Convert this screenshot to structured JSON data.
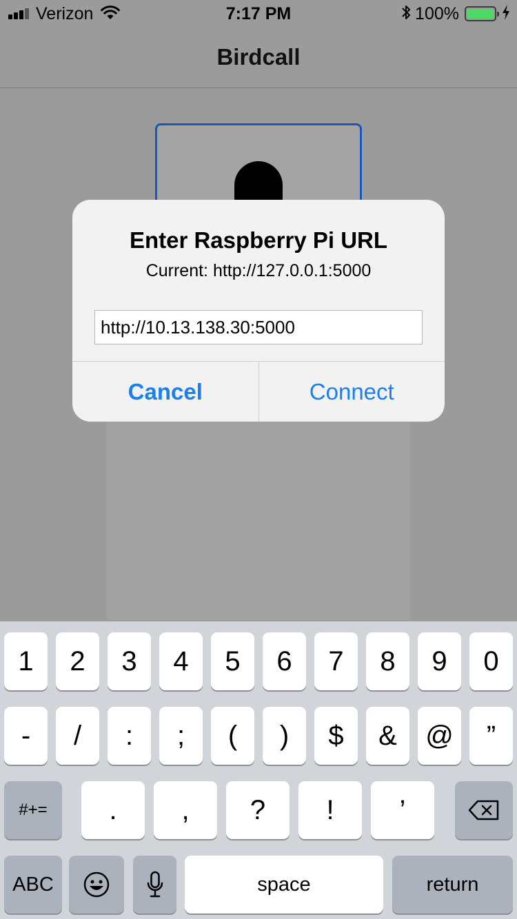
{
  "status_bar": {
    "carrier": "Verizon",
    "time": "7:17 PM",
    "battery_percent": "100%",
    "battery_level": 1.0,
    "icons": [
      "signal-bars-icon",
      "wifi-icon",
      "bluetooth-icon",
      "battery-icon",
      "charging-bolt-icon"
    ]
  },
  "nav": {
    "title": "Birdcall"
  },
  "background": {
    "icon": "microphone-icon"
  },
  "alert": {
    "title": "Enter Raspberry Pi URL",
    "message": "Current: http://127.0.0.1:5000",
    "input_value": "http://10.13.138.30:5000",
    "cancel_label": "Cancel",
    "connect_label": "Connect"
  },
  "keyboard": {
    "row1": [
      "1",
      "2",
      "3",
      "4",
      "5",
      "6",
      "7",
      "8",
      "9",
      "0"
    ],
    "row2": [
      "-",
      "/",
      ":",
      ";",
      "(",
      ")",
      "$",
      "&",
      "@",
      "”"
    ],
    "row3": [
      ".",
      ",",
      "?",
      "!",
      "’"
    ],
    "symbols_label": "#+=",
    "abc_label": "ABC",
    "space_label": "space",
    "return_label": "return",
    "icons": [
      "delete-icon",
      "emoji-icon",
      "dictation-icon"
    ]
  },
  "colors": {
    "accent": "#1a7ff0",
    "battery_fill": "#4cd964",
    "card_border": "#1a56b8"
  }
}
